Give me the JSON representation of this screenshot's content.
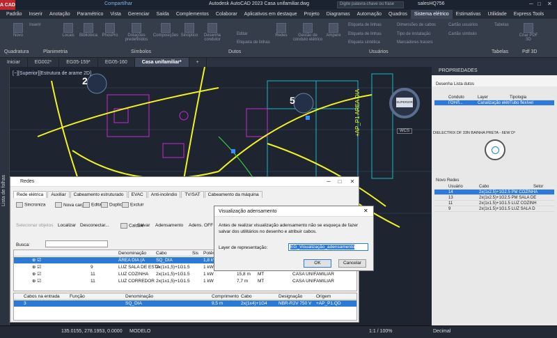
{
  "titlebar": {
    "app_badge": "A CAD",
    "share": "Compartilhar",
    "title": "Autodesk AutoCAD 2023   Casa unifamiliar.dwg",
    "search_placeholder": "Digite palavra-chave ou frase",
    "user": "salesHQ756"
  },
  "menu": [
    "Padrão",
    "Inserir",
    "Anotação",
    "Paramétrico",
    "Vista",
    "Gerenciar",
    "Saída",
    "Complementos",
    "Colaborar",
    "Aplicativos em destaque",
    "Projeto",
    "Diagramas",
    "Automação",
    "Quadros",
    "Sistema elétrico",
    "Estimativas",
    "Utilidade",
    "Express Tools"
  ],
  "menu_active": "Sistema elétrico",
  "ribbon": {
    "groups": [
      "Quadratura",
      "Planimetria",
      "Símbolos",
      "Dutos",
      "Usuários",
      "Tabelas",
      "Pdf 3D"
    ],
    "buttons": [
      "Novo",
      "Locais",
      "Biblioteca",
      "PhosPro",
      "Dotações predefinidos",
      "Composições",
      "Sinóptico",
      "Desenha condutor",
      "Redes",
      "Gestão de conduto elétrico",
      "Ampere",
      "Criar PDF 3D"
    ],
    "small": [
      "Inserir",
      "Editar",
      "Etiqueta de linhas",
      "Etiqueta de linhas",
      "Etiqueta de linhas",
      "Etiqueta sintética",
      "Dimensões de cabos",
      "Tipo de instalação",
      "Marcadores tracers",
      "Cartão usuários",
      "Cartão símbolo",
      "Tabelas"
    ]
  },
  "doctabs": [
    "Iniciar",
    "EG002*",
    "EG05-159*",
    "EG05-160",
    "Casa unifamiliar*",
    "+"
  ],
  "doctab_active": "Casa unifamiliar*",
  "viewport": {
    "view_label": "[−][Superior][Estrutura de arame 2D]",
    "marker_2": "2",
    "marker_5": "5",
    "compass_label": "SUPERIOR",
    "wcs": "WCS",
    "side_tab": "Lista de folhas",
    "vertical_text": "+AP_P1 AREA DIA"
  },
  "properties": {
    "title": "PROPRIEDADES",
    "tools": [
      "Desenha",
      "Lista dutos"
    ],
    "headers": [
      "Conduto",
      "Layer",
      "Tipologia"
    ],
    "row": [
      "ГОНЛ...",
      "Canalização elétri",
      "Tubo flexível"
    ],
    "cable_desc": "DIELECTRIX DF 33N  BAINHA PRETA - 6EW D³",
    "tools2": [
      "Novo",
      "Redes"
    ],
    "user_headers": [
      "Usuário",
      "Cabo",
      "Setor"
    ],
    "user_rows": [
      [
        "14",
        "2x(1x2.5)+1G2.5 PM COZINHA"
      ],
      [
        "13",
        "2x(1x2.5)+1G2.5 PM SALA DE"
      ],
      [
        "11",
        "2x(1x1.5)+1G1.5 LUZ COZINH"
      ],
      [
        "9",
        "2x(1x1.5)+1G1.5 LUZ SALA D"
      ]
    ]
  },
  "status": {
    "coords": "135.0155, 278.1953, 0.0000",
    "mode": "MODELO",
    "scale": "1:1 / 100%",
    "units": "Decimal"
  },
  "redes": {
    "title": "Redes",
    "tabs": [
      "Rede elétrica",
      "Auxiliar",
      "Cabeamento estruturado",
      "EVAC",
      "Anti-incêndio",
      "TV/SAT",
      "Cabeamento da máquina"
    ],
    "toolbar1": [
      "Sincroniza",
      "Nova carga",
      "Editar",
      "Duplicar",
      "Excluir"
    ],
    "toolbar2": [
      "Selecionar objetos",
      "Localizar",
      "Desconectar...",
      "Calcule",
      "Salvar",
      "Adensamento",
      "Adens. OFF"
    ],
    "search_label": "Busca:",
    "grid_headers": [
      "Denominação",
      "Cabo",
      "Sis",
      "Potênc"
    ],
    "rows": [
      {
        "id": "",
        "name": "ÁREA DIA (A",
        "cable": "SQ_DIA",
        "power": "1,8 kW",
        "len": "",
        "mat": "",
        "dest": ""
      },
      {
        "id": "9",
        "name": "LUZ SALA DE ESTA",
        "cable": "2x(1x1,5)+1G1.5",
        "power": "1 kW",
        "len": "15,0 m",
        "mat": "MT",
        "dest": "CASA UNIFAMILIAR"
      },
      {
        "id": "11",
        "name": "LUZ COZINHA",
        "cable": "2x(1x1,5)+1G1.5",
        "power": "1 kW",
        "len": "15,8 m",
        "mat": "MT",
        "dest": "CASA UNIFAMILIAR"
      },
      {
        "id": "11",
        "name": "LUZ CORREDOR",
        "cable": "2x(1x1,5)+1G1.5",
        "power": "1 kW",
        "len": "7,7 m",
        "mat": "MT",
        "dest": "CASA UNIFAMILIAR"
      }
    ],
    "grid2_headers": [
      "Cabos na entrada",
      "Função",
      "Denominação",
      "Comprimento",
      "Cabo",
      "Designação",
      "Origem"
    ],
    "grid2_row": [
      "3",
      "",
      "SQ_DIA",
      "9,5 m",
      "2x(1x4)+1G4",
      "NBR-R2V 750 V",
      "+AP_P1.QD"
    ]
  },
  "dialog": {
    "title": "Visualização adensamento",
    "message": "Antes de realizar visualização adensamento não se esqueça de fazer salvar dos utilitários no desenho e atribuir cabos.",
    "label": "Layer de representação:",
    "value": "EG_Visualização_adensamento",
    "ok": "OK",
    "cancel": "Cancelar"
  }
}
